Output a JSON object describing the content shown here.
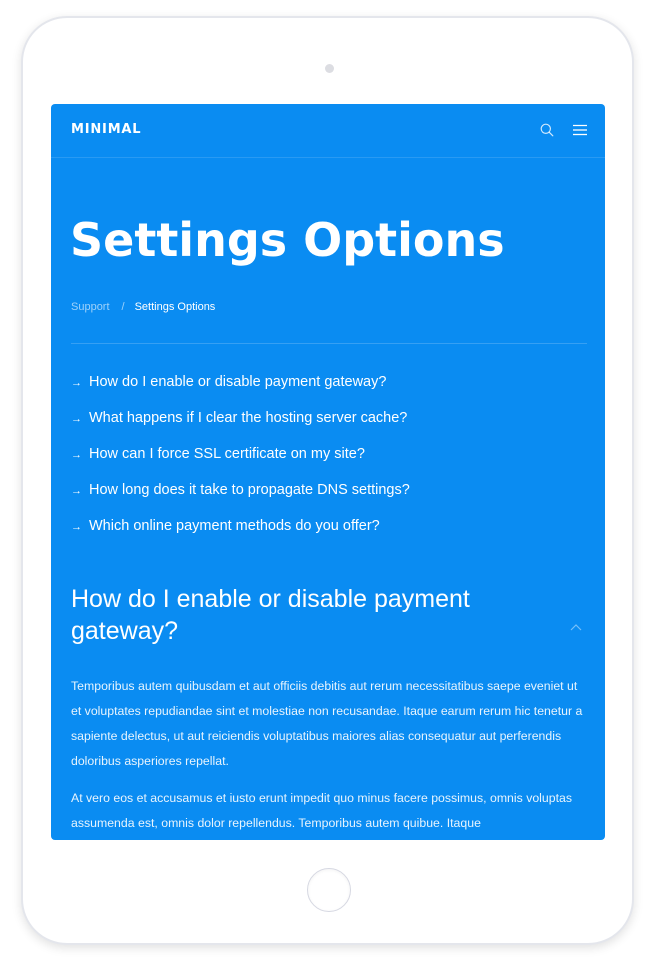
{
  "header": {
    "brand": "MINIMAL",
    "search_icon": "search-icon",
    "menu_icon": "hamburger-menu-icon"
  },
  "page": {
    "title": "Settings Options",
    "breadcrumb": {
      "parent": "Support",
      "separator": "/",
      "current": "Settings Options"
    }
  },
  "faq": {
    "arrow": "→",
    "items": [
      {
        "label": "How do I enable or disable payment gateway?"
      },
      {
        "label": "What happens if I clear the hosting server cache?"
      },
      {
        "label": "How can I force SSL certificate on my site?"
      },
      {
        "label": "How long does it take to propagate DNS settings?"
      },
      {
        "label": "Which online payment methods do you offer?"
      }
    ]
  },
  "answer": {
    "title": "How do I enable or disable payment gateway?",
    "collapse_icon": "chevron-up-icon",
    "paragraphs": [
      "Temporibus autem quibusdam et aut officiis debitis aut rerum necessitatibus saepe eveniet ut et voluptates repudiandae sint et molestiae non recusandae. Itaque earum rerum hic tenetur a sapiente delectus, ut aut reiciendis voluptatibus maiores alias consequatur aut perferendis doloribus asperiores repellat.",
      "At vero eos et accusamus et iusto erunt impedit quo minus facere possimus, omnis voluptas assumenda est, omnis dolor repellendus. Temporibus autem quibue. Itaque"
    ]
  },
  "colors": {
    "screen_background": "#0a8cf2",
    "text": "#ffffff",
    "device_frame": "#ffffff"
  }
}
